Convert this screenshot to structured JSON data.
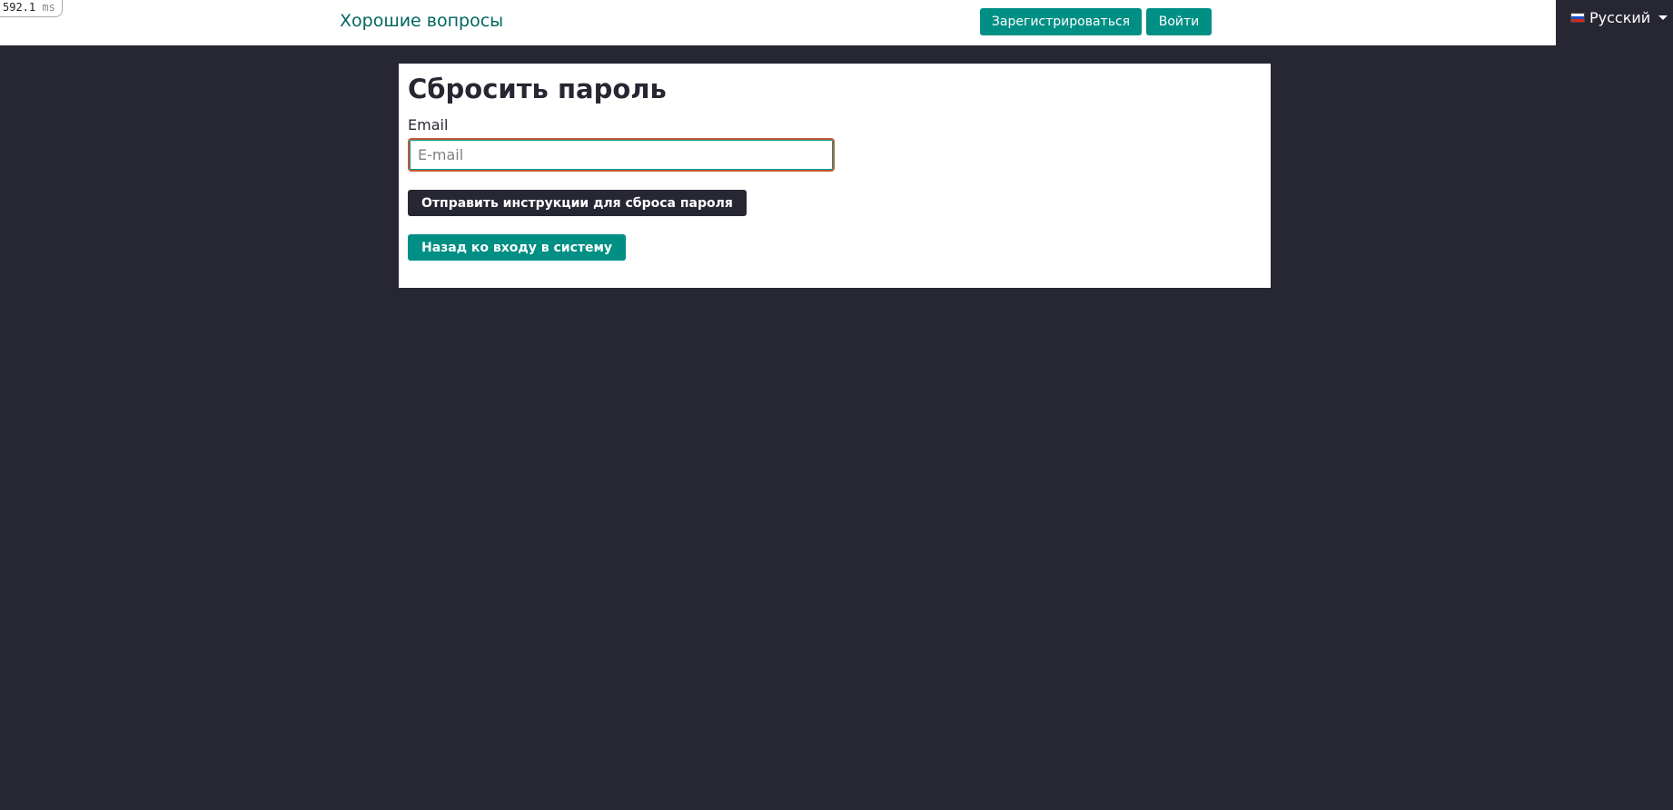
{
  "debug": {
    "timer_value": "592.1",
    "timer_unit": "ms"
  },
  "header": {
    "brand": "Хорошие вопросы",
    "register_label": "Зарегистрироваться",
    "login_label": "Войти"
  },
  "language": {
    "selected": "Русский",
    "flag_icon": "russia-flag-icon"
  },
  "form": {
    "title": "Сбросить пароль",
    "email_label": "Email",
    "email_placeholder": "E-mail",
    "email_value": "",
    "send_button": "Отправить инструкции для сброса пароля",
    "back_button": "Назад ко входу в систему"
  },
  "colors": {
    "accent": "#008f85",
    "brand_text": "#00665f",
    "dark": "#272733",
    "input_focus_border": "#c1593a"
  }
}
